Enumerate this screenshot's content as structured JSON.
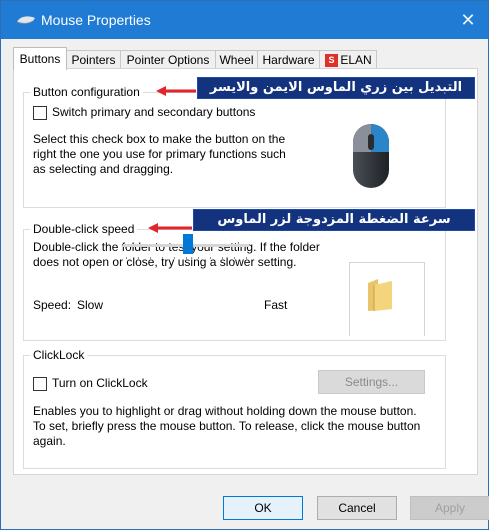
{
  "window": {
    "title": "Mouse Properties",
    "close": "✕"
  },
  "tabs": [
    {
      "label": "Buttons",
      "active": true
    },
    {
      "label": "Pointers",
      "active": false
    },
    {
      "label": "Pointer Options",
      "active": false
    },
    {
      "label": "Wheel",
      "active": false
    },
    {
      "label": "Hardware",
      "active": false
    },
    {
      "label": "ELAN",
      "active": false
    }
  ],
  "button_config": {
    "group_title": "Button configuration",
    "checkbox_label": "Switch primary and secondary buttons",
    "checked": false,
    "description": "Select this check box to make the button on the right the one you use for primary functions such as selecting and dragging."
  },
  "double_click": {
    "group_title": "Double-click speed",
    "description": "Double-click the folder to test your setting. If the folder does not open or close, try using a slower setting.",
    "speed_label": "Speed:",
    "slow_label": "Slow",
    "fast_label": "Fast",
    "speed_level": 0.52
  },
  "clicklock": {
    "group_title": "ClickLock",
    "checkbox_label": "Turn on ClickLock",
    "checked": false,
    "settings_button": "Settings...",
    "description": "Enables you to highlight or drag without holding down the mouse button. To set, briefly press the mouse button. To release, click the mouse button again."
  },
  "annotations": {
    "callout_1": "التبديل بين زري الماوس الايمن والايسر",
    "callout_2": "سرعة الضغطة المزدوجة لزر الماوس"
  },
  "footer": {
    "ok": "OK",
    "cancel": "Cancel",
    "apply": "Apply"
  },
  "colors": {
    "titlebar": "#1f7bd3",
    "accent": "#0078d7",
    "callout_bg": "#13337f",
    "arrow": "#e1252a"
  }
}
